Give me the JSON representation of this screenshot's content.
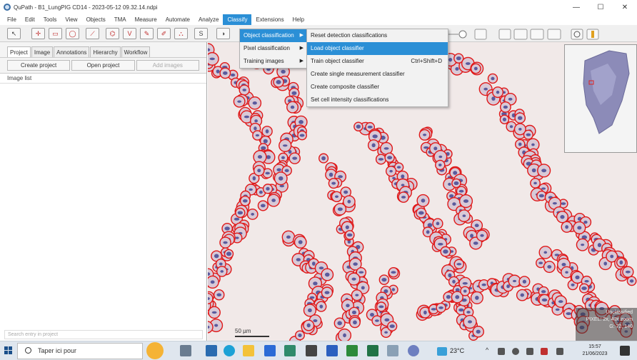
{
  "window": {
    "title": "QuPath - B1_LungPIG CD14 - 2023-05-12 09.32.14.ndpi",
    "controls": [
      "—",
      "☐",
      "✕"
    ]
  },
  "menubar": {
    "items": [
      "File",
      "Edit",
      "Tools",
      "View",
      "Objects",
      "TMA",
      "Measure",
      "Automate",
      "Analyze",
      "Classify",
      "Extensions",
      "Help"
    ],
    "active": "Classify"
  },
  "toolbar": {
    "buttons": [
      "↖",
      "✛",
      "▭",
      "◯",
      "⟋",
      "⌬",
      "V",
      "✎",
      "✐",
      "⛬",
      "S",
      "◑"
    ]
  },
  "project_panel": {
    "tabs": [
      "Project",
      "Image",
      "Annotations",
      "Hierarchy",
      "Workflow"
    ],
    "selected_tab": "Project",
    "buttons": {
      "create": "Create project",
      "open": "Open project",
      "add": "Add images"
    },
    "image_list_label": "Image list",
    "search_placeholder": "Search entry in project"
  },
  "classify_menu": {
    "items": [
      {
        "label": "Object classification",
        "highlighted": true
      },
      {
        "label": "Pixel classification",
        "highlighted": false
      },
      {
        "label": "Training images",
        "highlighted": false
      }
    ]
  },
  "object_classification_submenu": {
    "items": [
      {
        "label": "Reset detection classifications",
        "shortcut": "",
        "highlighted": false
      },
      {
        "label": "Load object classifier",
        "shortcut": "",
        "highlighted": true
      },
      {
        "label": "Train object classifier",
        "shortcut": "Ctrl+Shift+D",
        "highlighted": false
      },
      {
        "label": "Create single measurement classifier",
        "shortcut": "",
        "highlighted": false
      },
      {
        "label": "Create composite classifier",
        "shortcut": "",
        "highlighted": false
      },
      {
        "label": "Set cell intensity classifications",
        "shortcut": "",
        "highlighted": false
      }
    ]
  },
  "viewer": {
    "scale_bar": "50 µm",
    "class_info": {
      "line1": "Unclassified",
      "line2": "PIXEL: 2x, 40x zoom",
      "line3": "G: 72, 140"
    }
  },
  "taskbar": {
    "search_placeholder": "Taper ici pour",
    "weather": "23°C",
    "time": "15:57",
    "date": "21/06/2023"
  },
  "colors": {
    "menu_highlight": "#2b8fd6",
    "cell_outline": "#e01818",
    "nucleus": "#3a3f8f"
  }
}
